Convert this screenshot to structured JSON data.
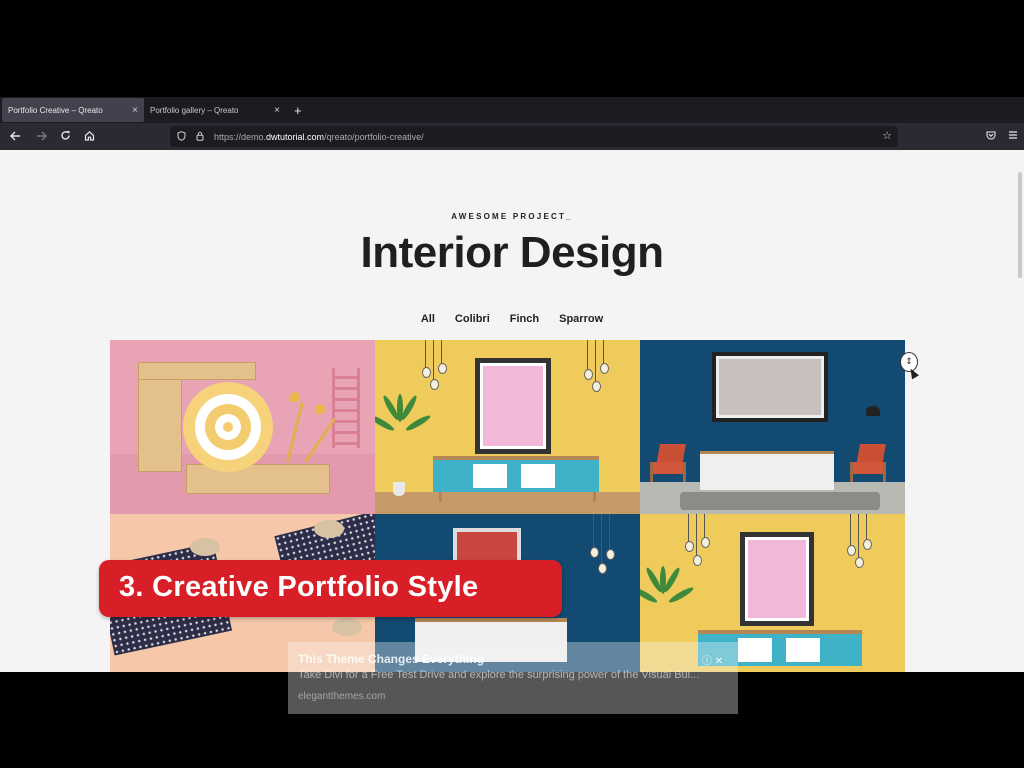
{
  "tabs": [
    {
      "label": "Portfolio Creative – Qreato",
      "active": true
    },
    {
      "label": "Portfolio gallery – Qreato",
      "active": false
    }
  ],
  "newtab": "+",
  "close_glyph": "×",
  "nav": {
    "back_icon": "arrow-left-icon",
    "forward_icon": "arrow-right-icon",
    "reload_icon": "reload-icon",
    "home_icon": "home-icon",
    "url_prefix": "https://demo.",
    "url_domain": "dwtutorial.com",
    "url_path": "/qreato/portfolio-creative/"
  },
  "page": {
    "eyebrow": "AWESOME PROJECT_",
    "title": "Interior Design",
    "filters": [
      "All",
      "Colibri",
      "Finch",
      "Sparrow"
    ]
  },
  "badge": "3. Creative Portfolio Style",
  "ad": {
    "headline": "This Theme Changes Everything",
    "description": "Take Divi for a Free Test Drive and explore the surprising power of the Visual Bui...",
    "source": "elegantthemes.com",
    "controls": "ⓘ ✕"
  },
  "colors": {
    "badge": "#d81f27",
    "page_bg": "#f4f4f4",
    "pink": "#e8a3b5",
    "yellow": "#efcb5c",
    "navy": "#134a72"
  }
}
